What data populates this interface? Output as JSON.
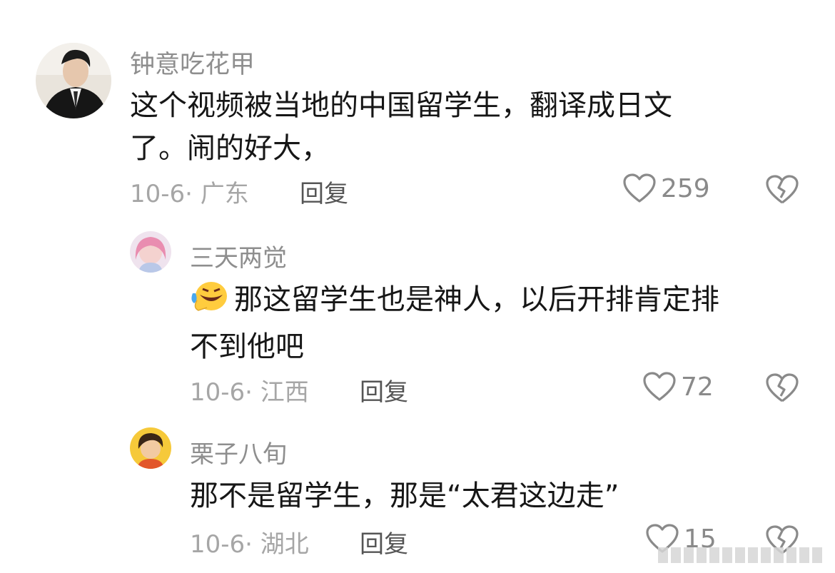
{
  "comments": [
    {
      "username": "钟意吃花甲",
      "text_lines": [
        "这个视频被当地的中国留学生，翻译成日文",
        "了。闹的好大，"
      ],
      "date_location": "10-6· 广东",
      "reply_label": "回复",
      "like_count": "259"
    },
    {
      "username": "三天两觉",
      "text_lines": [
        "那这留学生也是神人，以后开排肯定排",
        "不到他吧"
      ],
      "date_location": "10-6· 江西",
      "reply_label": "回复",
      "like_count": "72"
    },
    {
      "username": "栗子八旬",
      "text_lines": [
        "那不是留学生，那是“太君这边走”"
      ],
      "date_location": "10-6· 湖北",
      "reply_label": "回复",
      "like_count": "15"
    }
  ],
  "icons": {
    "like": "heart-outline-icon",
    "dislike": "broken-heart-icon",
    "emoji": "laughing-tears-emoji"
  },
  "colors": {
    "username": "#8e8e8e",
    "meta": "#a6a6a6",
    "body_text": "#161616",
    "icon_stroke": "#8a8a8a"
  }
}
